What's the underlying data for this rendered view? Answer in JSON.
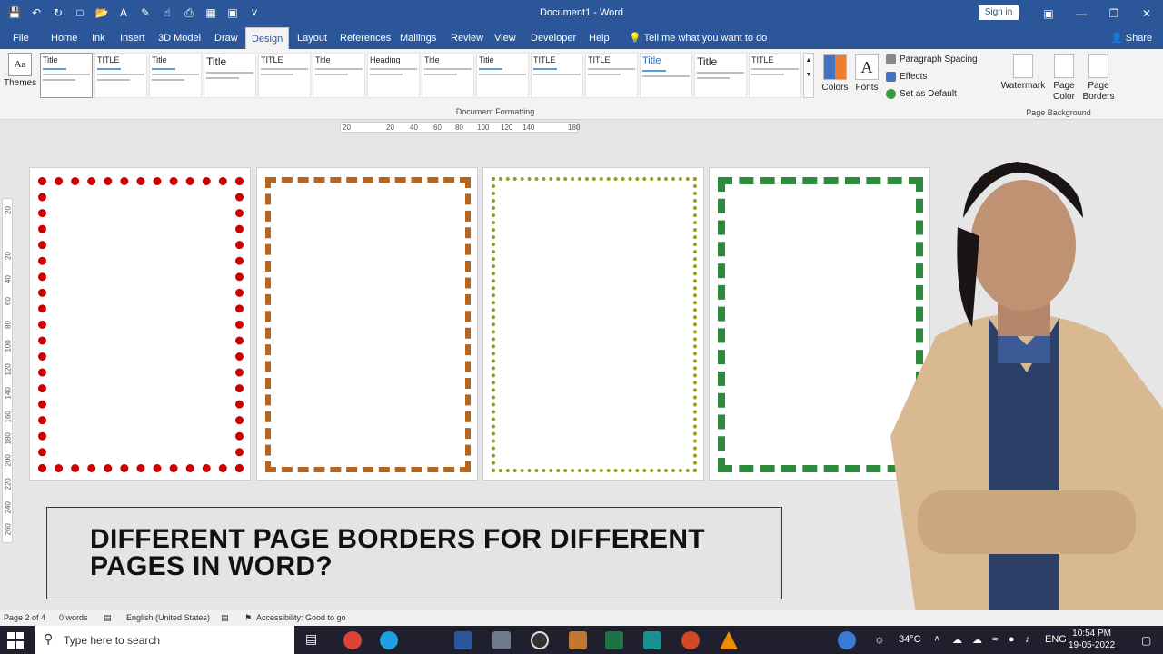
{
  "window": {
    "title": "Document1  -  Word",
    "signin": "Sign in"
  },
  "tabs": [
    {
      "label": "File"
    },
    {
      "label": "Home"
    },
    {
      "label": "Ink"
    },
    {
      "label": "Insert"
    },
    {
      "label": "3D Model"
    },
    {
      "label": "Draw"
    },
    {
      "label": "Design"
    },
    {
      "label": "Layout"
    },
    {
      "label": "References"
    },
    {
      "label": "Mailings"
    },
    {
      "label": "Review"
    },
    {
      "label": "View"
    },
    {
      "label": "Developer"
    },
    {
      "label": "Help"
    }
  ],
  "tellme": "Tell me what you want to do",
  "share": "Share",
  "ribbon": {
    "themes": "Themes",
    "doc_formatting": "Document Formatting",
    "colors": "Colors",
    "fonts": "Fonts",
    "paragraph_spacing": "Paragraph Spacing",
    "effects": "Effects",
    "set_default": "Set as Default",
    "watermark": "Watermark",
    "page_color": "Page Color",
    "page_borders": "Page Borders",
    "page_background": "Page Background",
    "style_titles": [
      "Title",
      "TITLE",
      "Title",
      "Title",
      "TITLE",
      "Title",
      "Heading",
      "Title",
      "Title",
      "TITLE",
      "TITLE",
      "Title",
      "Title",
      "TITLE"
    ]
  },
  "ruler": [
    "20",
    "20",
    "40",
    "60",
    "80",
    "100",
    "120",
    "140",
    "180"
  ],
  "vruler": [
    "20",
    "20",
    "40",
    "60",
    "80",
    "100",
    "120",
    "140",
    "160",
    "180",
    "200",
    "220",
    "240",
    "260"
  ],
  "heading": {
    "line1": "DIFFERENT PAGE BORDERS FOR DIFFERENT",
    "line2": "PAGES IN WORD?"
  },
  "status": {
    "page": "Page 2 of 4",
    "words": "0 words",
    "language": "English (United States)",
    "accessibility": "Accessibility: Good to go"
  },
  "taskbar": {
    "search_placeholder": "Type here to search",
    "temp": "34°C",
    "lang": "ENG",
    "time": "10:54 PM",
    "date": "19-05-2022"
  }
}
